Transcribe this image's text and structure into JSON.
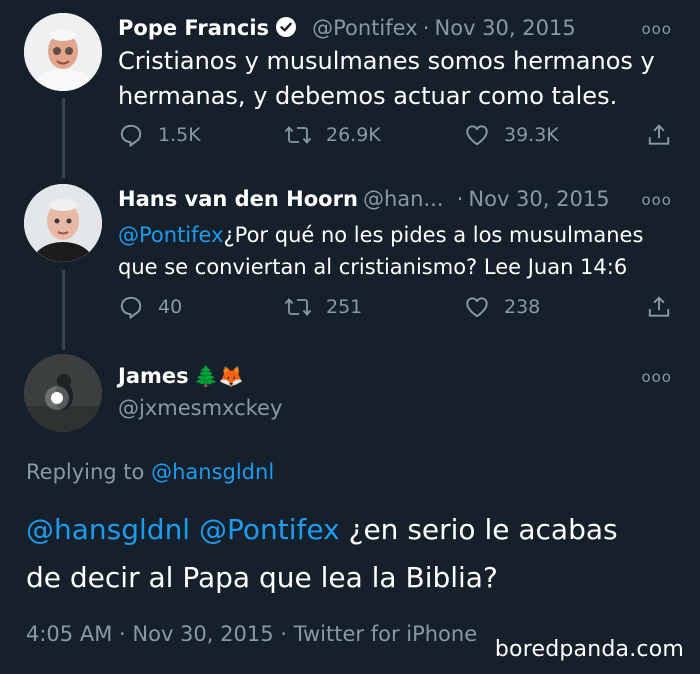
{
  "tweets": [
    {
      "name": "Pope Francis",
      "handle": "@Pontifex",
      "separator": "·",
      "date": "Nov 30, 2015",
      "text_line1": "Cristianos y musulmanes somos hermanos y",
      "text_line2": "hermanas, y debemos actuar como tales.",
      "replies": "1.5K",
      "retweets": "26.9K",
      "likes": "39.3K"
    },
    {
      "name": "Hans van den Hoorn",
      "handle": "@han...",
      "separator": "·",
      "date": "Nov 30, 2015",
      "mention": "@Pontifex",
      "text_line1_rest": "¿Por qué no les pides a los musulmanes",
      "text_line2": "que se conviertan al cristianismo?  Lee Juan 14:6",
      "replies": "40",
      "retweets": "251",
      "likes": "238"
    }
  ],
  "main_tweet": {
    "name": "James",
    "emoji_tree": "🌲",
    "emoji_fox": "🦊",
    "handle": "@jxmesmxckey",
    "replying_prefix": "Replying to",
    "replying_to": "@hansgldnl",
    "mention1": "@hansgldnl",
    "mention2": "@Pontifex",
    "text_rest": "¿en serio le acabas",
    "text_line2": "de decir al Papa que lea la Biblia?",
    "time": "4:05 AM",
    "separator": "·",
    "date": "Nov 30, 2015",
    "client": "Twitter for iPhone"
  },
  "more_icon": "more-dots-icon",
  "watermark": "boredpanda.com",
  "colors": {
    "background": "#15202b",
    "link": "#1d9bf0",
    "muted": "#8899a6",
    "verified": "#ffffff"
  }
}
